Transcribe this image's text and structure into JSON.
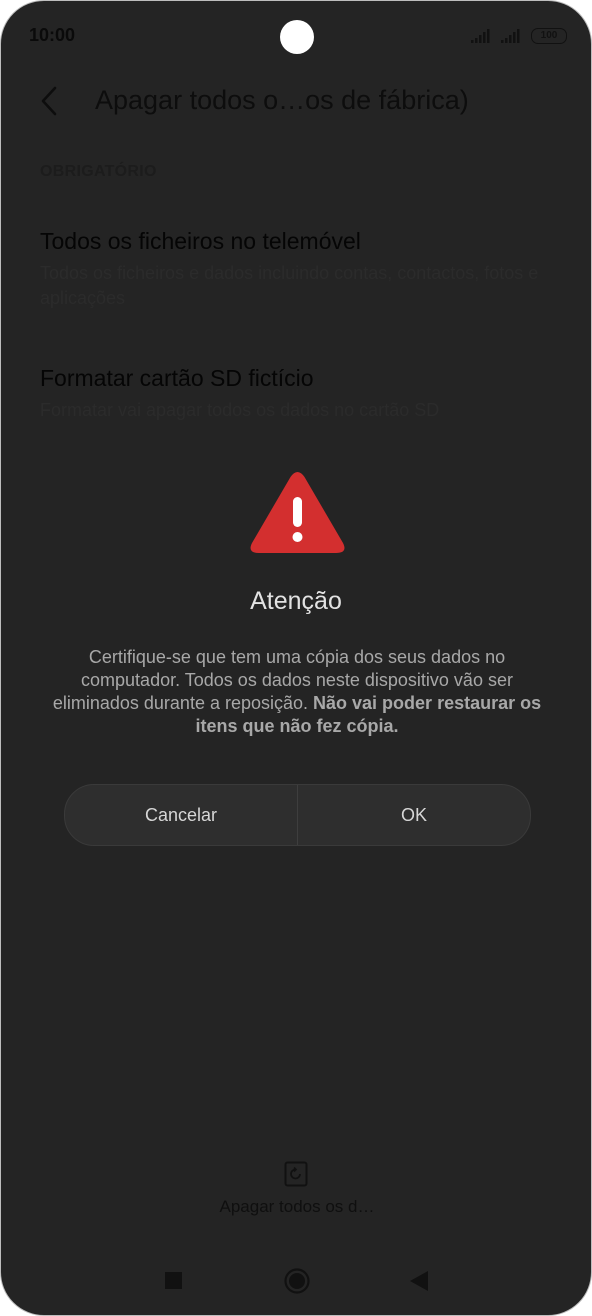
{
  "status_bar": {
    "time": "10:00",
    "battery": "100"
  },
  "header": {
    "title": "Apagar todos o…os de fábrica)"
  },
  "section": {
    "label": "OBRIGATÓRIO"
  },
  "items": [
    {
      "title": "Todos os ficheiros no telemóvel",
      "description": "Todos os ficheiros e dados incluindo contas, contactos, fotos e aplicações"
    },
    {
      "title": "Formatar cartão SD fictício",
      "description": "Formatar vai apagar todos os dados no cartão SD"
    }
  ],
  "dialog": {
    "icon": "warning-icon",
    "title": "Atenção",
    "message": "Certifique-se que tem uma cópia dos seus dados no computador. Todos os dados neste dispositivo vão ser eliminados durante a reposição.",
    "message_bold": "Não vai poder restaurar os itens que não fez cópia.",
    "cancel_label": "Cancelar",
    "ok_label": "OK",
    "accent_color": "#d32f2f"
  },
  "bottom_action": {
    "icon": "reset-icon",
    "label": "Apagar todos os d…"
  },
  "nav_bar": {
    "recents_icon": "square-icon",
    "home_icon": "home-circle-icon",
    "back_icon": "triangle-back-icon"
  }
}
